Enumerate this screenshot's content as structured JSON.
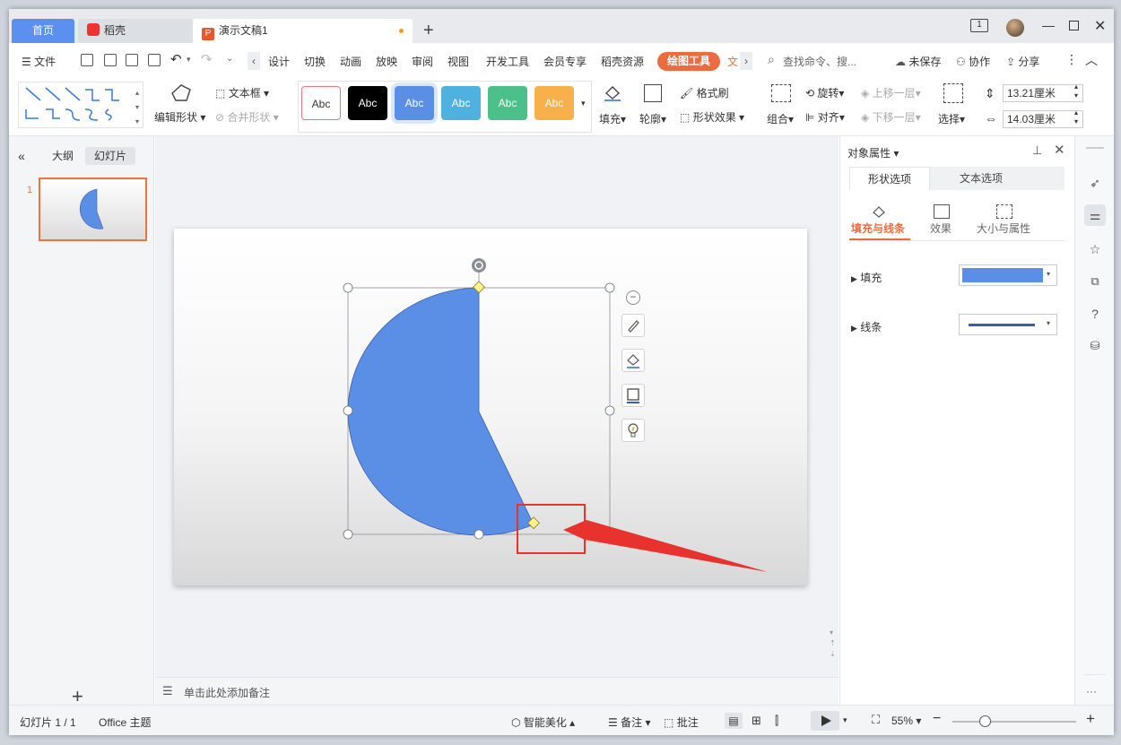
{
  "titlebar": {
    "tabs": [
      {
        "label": "首页"
      },
      {
        "label": "稻壳"
      },
      {
        "label": "演示文稿1"
      }
    ],
    "add_tab": "+",
    "window_badge": "1"
  },
  "menu": {
    "file": "文件",
    "items": [
      "设计",
      "切换",
      "动画",
      "放映",
      "审阅",
      "视图",
      "开发工具",
      "会员专享",
      "稻壳资源"
    ],
    "drawing_tools": "绘图工具",
    "text_tools": "文",
    "search_placeholder": "查找命令、搜...",
    "unsaved": "未保存",
    "collaborate": "协作",
    "share": "分享"
  },
  "ribbon": {
    "edit_shape": "编辑形状",
    "textbox": "文本框",
    "merge_shape": "合并形状",
    "style_samples": [
      "Abc",
      "Abc",
      "Abc",
      "Abc",
      "Abc",
      "Abc"
    ],
    "fill": "填充",
    "outline": "轮廓",
    "format_painter": "格式刷",
    "shape_effects": "形状效果",
    "group": "组合",
    "rotate": "旋转",
    "align": "对齐",
    "bring_forward": "上移一层",
    "send_backward": "下移一层",
    "select": "选择",
    "height_value": "13.21厘米",
    "width_value": "14.03厘米"
  },
  "left_panel": {
    "outline_tab": "大纲",
    "slides_tab": "幻灯片",
    "slide_number": "1",
    "add_slide": "+"
  },
  "notes": {
    "placeholder": "单击此处添加备注"
  },
  "right_panel": {
    "title": "对象属性",
    "tab_shape": "形状选项",
    "tab_text": "文本选项",
    "sub_fill_line": "填充与线条",
    "sub_effects": "效果",
    "sub_size": "大小与属性",
    "fill_label": "填充",
    "line_label": "线条",
    "fill_color": "#5b8fe6",
    "line_color": "#3b5ea8"
  },
  "statusbar": {
    "slide_info": "幻灯片 1 / 1",
    "theme": "Office 主题",
    "smart_beautify": "智能美化",
    "notes": "备注",
    "comments": "批注",
    "zoom": "55%",
    "more": "···"
  },
  "colors": {
    "accent": "#ed6c3f",
    "home_tab": "#5b8ff0",
    "shape_fill": "#5b8fe6",
    "highlight_red": "#e8322d"
  }
}
